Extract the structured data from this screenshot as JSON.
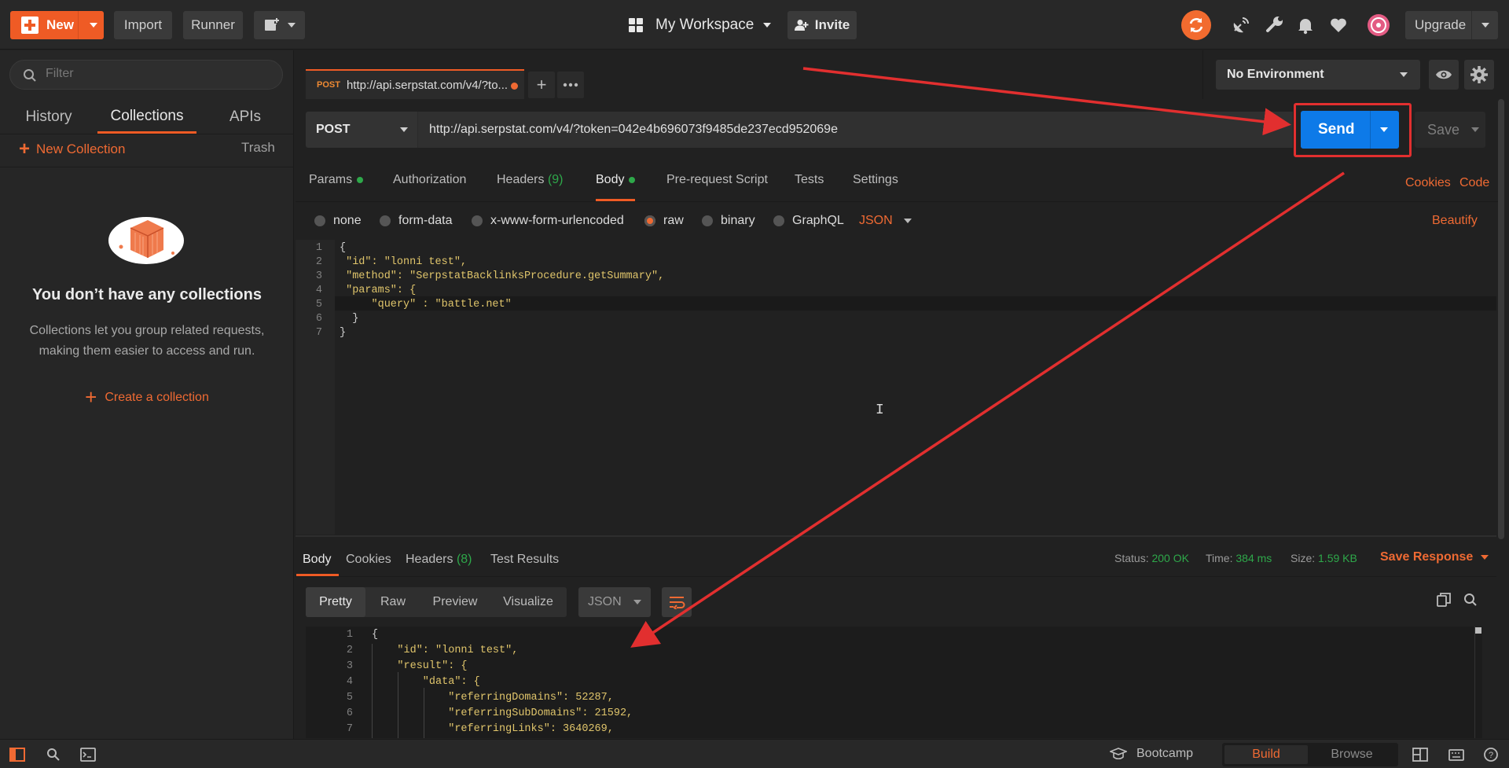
{
  "topbar": {
    "new_label": "New",
    "import_label": "Import",
    "runner_label": "Runner",
    "workspace_label": "My Workspace",
    "invite_label": "Invite",
    "upgrade_label": "Upgrade"
  },
  "sidebar": {
    "filter_placeholder": "Filter",
    "tabs": [
      {
        "label": "History"
      },
      {
        "label": "Collections"
      },
      {
        "label": "APIs"
      }
    ],
    "new_collection_label": "New Collection",
    "trash_label": "Trash",
    "empty_title": "You don’t have any collections",
    "empty_desc": "Collections let you group related requests, making them easier to access and run.",
    "create_collection_label": "Create a collection"
  },
  "request_tab": {
    "method": "POST",
    "title": "http://api.serpstat.com/v4/?to..."
  },
  "environment": {
    "selected": "No Environment"
  },
  "request": {
    "method": "POST",
    "url": "http://api.serpstat.com/v4/?token=042e4b696073f9485de237ecd952069e",
    "send_label": "Send",
    "save_label": "Save",
    "tabs": [
      {
        "label": "Params"
      },
      {
        "label": "Authorization"
      },
      {
        "label": "Headers"
      },
      {
        "label": "Body"
      },
      {
        "label": "Pre-request Script"
      },
      {
        "label": "Tests"
      },
      {
        "label": "Settings"
      }
    ],
    "headers_count": "(9)",
    "cookies_label": "Cookies",
    "code_label": "Code",
    "body_modes": [
      "none",
      "form-data",
      "x-www-form-urlencoded",
      "raw",
      "binary",
      "GraphQL"
    ],
    "body_format": "JSON",
    "beautify_label": "Beautify",
    "body_lines": [
      "{",
      " \"id\": \"lonni test\",",
      " \"method\": \"SerpstatBacklinksProcedure.getSummary\",",
      " \"params\": {",
      "     \"query\" : \"battle.net\"",
      "  }",
      "}"
    ]
  },
  "response": {
    "tabs": [
      {
        "label": "Body"
      },
      {
        "label": "Cookies"
      },
      {
        "label": "Headers"
      },
      {
        "label": "Test Results"
      }
    ],
    "headers_count": "(8)",
    "status_label": "Status:",
    "status_value": "200 OK",
    "time_label": "Time:",
    "time_value": "384 ms",
    "size_label": "Size:",
    "size_value": "1.59 KB",
    "save_response_label": "Save Response",
    "view_modes": [
      "Pretty",
      "Raw",
      "Preview",
      "Visualize"
    ],
    "format": "JSON",
    "body_lines": [
      "{",
      "    \"id\": \"lonni test\",",
      "    \"result\": {",
      "        \"data\": {",
      "            \"referringDomains\": 52287,",
      "            \"referringSubDomains\": 21592,",
      "            \"referringLinks\": 3640269,"
    ]
  },
  "statusbar": {
    "bootcamp_label": "Bootcamp",
    "build_label": "Build",
    "browse_label": "Browse"
  },
  "colors": {
    "accent": "#ef5b25",
    "send_blue": "#0d7ae8",
    "annotation_red": "#e22f2f",
    "success_green": "#2ea84a"
  }
}
